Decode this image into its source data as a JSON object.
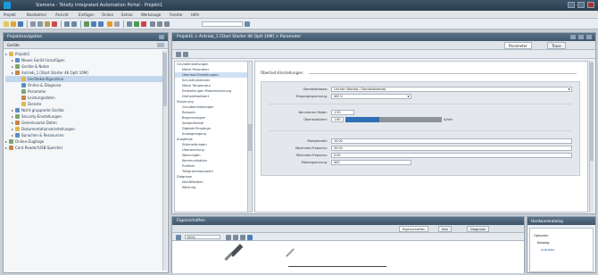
{
  "window": {
    "title": "Siemens - Totally Integrated Automation Portal - Projekt1"
  },
  "menu": [
    "Projekt",
    "Bearbeiten",
    "Ansicht",
    "Einfügen",
    "Online",
    "Extras",
    "Werkzeuge",
    "Fenster",
    "Hilfe"
  ],
  "project_tree": {
    "title": "Projektnavigation",
    "subtitle": "Geräte",
    "items": [
      {
        "label": "Projekt1",
        "level": 0,
        "selected": false
      },
      {
        "label": "Neues Gerät hinzufügen",
        "level": 1,
        "selected": false
      },
      {
        "label": "Geräte & Netze",
        "level": 1,
        "selected": false
      },
      {
        "label": "Antrieb_1 [Start Starter 4K Optt 10M]",
        "level": 1,
        "selected": false
      },
      {
        "label": "Gerätekonfiguration",
        "level": 2,
        "selected": true
      },
      {
        "label": "Online & Diagnose",
        "level": 2,
        "selected": false
      },
      {
        "label": "Parameter",
        "level": 2,
        "selected": false
      },
      {
        "label": "Leistungsdaten",
        "level": 2,
        "selected": false
      },
      {
        "label": "Dienste",
        "level": 2,
        "selected": false
      },
      {
        "label": "Nicht gruppierte Geräte",
        "level": 1,
        "selected": false
      },
      {
        "label": "Security-Einstellungen",
        "level": 1,
        "selected": false
      },
      {
        "label": "Gemeinsame Daten",
        "level": 1,
        "selected": false
      },
      {
        "label": "Dokumentationseinstellungen",
        "level": 1,
        "selected": false
      },
      {
        "label": "Sprachen & Ressourcen",
        "level": 1,
        "selected": false
      },
      {
        "label": "Online-Zugänge",
        "level": 0,
        "selected": false
      },
      {
        "label": "Card Reader/USB-Speicher",
        "level": 0,
        "selected": false
      }
    ]
  },
  "editor": {
    "title": "Projekt1 > Antrieb_1 [Start Starter 4K Optt 10M] > Parameter",
    "tabs": [
      "Parameter",
      "Trace"
    ],
    "nav_items": [
      {
        "label": "Grundeinstellungen",
        "sel": false
      },
      {
        "label": "Motor Parameter",
        "sel": false
      },
      {
        "label": "Überlast-Einstellungen",
        "sel": true
      },
      {
        "label": "Schutzfunktionen",
        "sel": false
      },
      {
        "label": "Motor Temperatur",
        "sel": false
      },
      {
        "label": "Einstellungen Motorerkennung",
        "sel": false
      },
      {
        "label": "Drehzahlsollwert",
        "sel": false
      },
      {
        "label": "Steuerung",
        "sel": false
      },
      {
        "label": "Grundeinstellungen",
        "sel": false
      },
      {
        "label": "Rampen",
        "sel": false
      },
      {
        "label": "Begrenzungen",
        "sel": false
      },
      {
        "label": "Sollwertkanal",
        "sel": false
      },
      {
        "label": "Digitale Eingänge",
        "sel": false
      },
      {
        "label": "Analogeingang",
        "sel": false
      },
      {
        "label": "Ausgänge",
        "sel": false
      },
      {
        "label": "Störmeldungen",
        "sel": false
      },
      {
        "label": "Überwachung",
        "sel": false
      },
      {
        "label": "Warnungen",
        "sel": false
      },
      {
        "label": "Kommunikation",
        "sel": false
      },
      {
        "label": "Profinet",
        "sel": false
      },
      {
        "label": "Telegrammauswahl",
        "sel": false
      },
      {
        "label": "Diagnose",
        "sel": false
      },
      {
        "label": "Identifikation",
        "sel": false
      },
      {
        "label": "Wartung",
        "sel": false
      }
    ],
    "section": "Überlast-Einstellungen",
    "fields_top": [
      {
        "label": "Überlastklasse:",
        "value": "Leichte Überlast / Standardbetrieb",
        "type": "dropdown"
      },
      {
        "label": "Eingangsspannung:",
        "value": "400 V",
        "type": "dropdown"
      }
    ],
    "fields_mid": [
      {
        "label": "Nennstrom Motor:",
        "value": "1.50"
      },
      {
        "label": "Überlaststrom:",
        "value": "1.60"
      }
    ],
    "overload_unit": "A/min",
    "overload_fraction": 0.35,
    "fields_bottom": [
      {
        "label": "Rampenzeit:",
        "value": "10.00"
      },
      {
        "label": "Maximale Frequenz:",
        "value": "50.00"
      },
      {
        "label": "Minimale Frequenz:",
        "value": "0.00"
      },
      {
        "label": "Motorspannung:",
        "value": "400"
      }
    ]
  },
  "inspector": {
    "title": "Eigenschaften",
    "tabs": [
      "Eigenschaften",
      "Info",
      "Diagnose"
    ],
    "toolbar_label": "100%"
  },
  "taskcard": {
    "title": "Hardwarekatalog",
    "items": [
      "Optionen",
      "Katalog",
      "Antriebe"
    ]
  },
  "colors": {
    "accent_blue": "#2f6fb3",
    "bar_grey": "#8d949b",
    "header_dark": "#3f566b"
  }
}
